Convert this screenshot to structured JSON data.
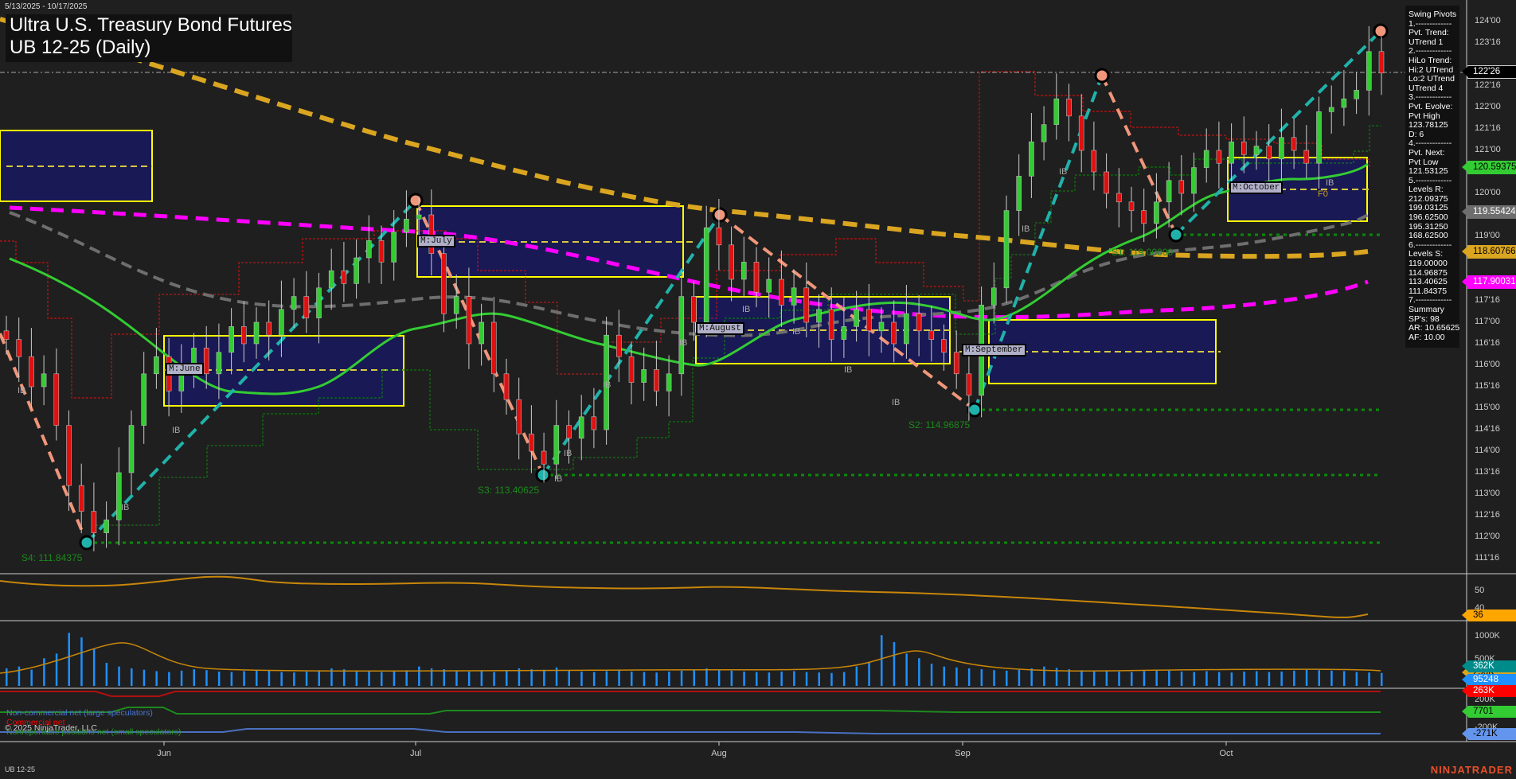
{
  "header": {
    "date_range": "5/13/2025 - 10/17/2025",
    "title_line1": "Ultra U.S. Treasury Bond Futures",
    "title_line2": "UB 12-25 (Daily)"
  },
  "swing_pivots": [
    "Swing Pivots",
    "1.-------------",
    "Pvt. Trend:",
    "UTrend 1",
    "2.-------------",
    "HiLo Trend:",
    "Hi:2 UTrend",
    "Lo:2 UTrend",
    "UTrend 4",
    "3.-------------",
    "Pvt. Evolve:",
    "Pvt High",
    "123.78125",
    "D: 6",
    "4.-------------",
    "Pvt. Next:",
    "Pvt Low",
    "121.53125",
    "5.-------------",
    "Levels R:",
    "212.09375",
    "199.03125",
    "196.62500",
    "195.31250",
    "168.62500",
    "6.-------------",
    "Levels S:",
    "119.00000",
    "114.96875",
    "113.40625",
    "111.84375",
    "7.-------------",
    "Summary",
    "SP's: 98",
    "AR: 10.65625",
    "AF: 10.00"
  ],
  "price_axis_ticks": [
    "124'00",
    "123'16",
    "122'16",
    "122'00",
    "121'16",
    "121'00",
    "120'00",
    "119'00",
    "117'16",
    "117'00",
    "116'16",
    "116'00",
    "115'16",
    "115'00",
    "114'16",
    "114'00",
    "113'16",
    "113'00",
    "112'16",
    "112'00",
    "111'16"
  ],
  "price_badges": [
    {
      "label": "122'26",
      "bg": "#000000",
      "fg": "#ffffff",
      "border": "#cccccc"
    },
    {
      "label": "120.59375",
      "bg": "#33cc33",
      "fg": "#000000",
      "border": "#33cc33"
    },
    {
      "label": "119.55424",
      "bg": "#6e6e6e",
      "fg": "#ffffff",
      "border": "#6e6e6e"
    },
    {
      "label": "118.60766",
      "bg": "#daa520",
      "fg": "#000000",
      "border": "#daa520"
    },
    {
      "label": "117.90031",
      "bg": "#ff00ff",
      "fg": "#ffffff",
      "border": "#ff00ff"
    }
  ],
  "indicator_axis": {
    "ticks": [
      "50",
      "40"
    ],
    "badge": "36"
  },
  "volume_axis": {
    "ticks": [
      "1000K",
      "500K"
    ],
    "badges": [
      "362K",
      "290K",
      "95248"
    ]
  },
  "cot_axis": {
    "ticks": [
      "200K",
      "-200K"
    ],
    "badges": [
      "263K",
      "7701",
      "-271K"
    ]
  },
  "month_boxes": [
    "M:June",
    "M:July",
    "M:August",
    "M:September",
    "M:October"
  ],
  "support_labels": [
    "S4: 111.84375",
    "S3: 113.40625",
    "S2: 114.96875",
    "S1: 119.00000"
  ],
  "ib_label": "IB",
  "fo_label": "F0",
  "x_axis": [
    "Jun",
    "Jul",
    "Aug",
    "Sep",
    "Oct"
  ],
  "legend": {
    "noncommercial": "Non-commercial net (large speculators)",
    "commercial": "Commercial net",
    "copyright": "© 2025 NinjaTrader, LLC",
    "nonreportable": "Nonreportable positions net (small speculators)"
  },
  "footer": {
    "instrument": "UB 12-25",
    "logo": "NINJATRADER"
  },
  "colors": {
    "up": "#33cc33",
    "down": "#e01010",
    "box_fill": "#191955",
    "box_stroke": "#ffff00",
    "teal": "#20b2aa",
    "salmon": "#f0967a",
    "orange_ma": "#daa520",
    "magenta_ma": "#ff00ff",
    "gray_ma": "#6e6e6e",
    "green_ma": "#33cc33",
    "volume": "#1e90ff"
  },
  "chart_data": {
    "type": "candlestick",
    "title": "Ultra U.S. Treasury Bond Futures UB 12-25 (Daily)",
    "x_range": [
      "5/13/2025",
      "10/17/2025"
    ],
    "ylim": [
      111.25,
      124.25
    ],
    "last_price": 122.8125,
    "closes": [
      116.6,
      116.2,
      115.5,
      115.8,
      114.6,
      113.2,
      112.6,
      112.1,
      112.4,
      113.5,
      114.6,
      115.8,
      116.2,
      115.4,
      115.9,
      116.4,
      115.8,
      116.3,
      116.9,
      116.5,
      117.0,
      116.7,
      117.3,
      117.6,
      117.1,
      117.8,
      118.2,
      117.9,
      118.5,
      118.9,
      118.4,
      119.1,
      119.4,
      119.5,
      118.6,
      117.2,
      117.6,
      116.5,
      117.0,
      115.8,
      115.2,
      114.4,
      114.0,
      113.7,
      114.6,
      114.3,
      114.8,
      114.5,
      116.7,
      116.2,
      115.6,
      115.9,
      115.4,
      115.8,
      117.6,
      117.0,
      119.2,
      118.8,
      118.0,
      118.4,
      117.7,
      118.0,
      117.4,
      117.8,
      117.0,
      117.3,
      116.6,
      116.9,
      117.3,
      116.8,
      117.0,
      116.5,
      117.2,
      116.8,
      116.6,
      116.3,
      115.8,
      115.3,
      117.4,
      117.8,
      119.6,
      120.4,
      121.2,
      121.6,
      122.2,
      121.8,
      121.0,
      120.5,
      120.0,
      119.8,
      119.6,
      119.3,
      119.8,
      120.3,
      120.0,
      120.6,
      121.0,
      120.7,
      121.2,
      120.9,
      121.1,
      120.8,
      121.3,
      121.0,
      120.7,
      121.9,
      122.0,
      122.2,
      122.4,
      123.3,
      122.8
    ],
    "pivots": [
      {
        "type": "low",
        "label": "S4",
        "value": 111.84375
      },
      {
        "type": "high",
        "value": 119.8
      },
      {
        "type": "low",
        "label": "S3",
        "value": 113.40625
      },
      {
        "type": "high",
        "value": 119.5
      },
      {
        "type": "low",
        "label": "S2",
        "value": 114.96875
      },
      {
        "type": "high",
        "value": 122.75
      },
      {
        "type": "low",
        "label": "S1",
        "value": 119.0
      },
      {
        "type": "high",
        "value": 123.78125
      }
    ],
    "volume_k": [
      380,
      420,
      350,
      600,
      700,
      1150,
      1050,
      800,
      500,
      420,
      380,
      350,
      320,
      300,
      330,
      360,
      340,
      310,
      300,
      320,
      350,
      330,
      300,
      290,
      310,
      340,
      380,
      360,
      330,
      310,
      300,
      320,
      340,
      420,
      380,
      360,
      330,
      310,
      320,
      300,
      340,
      380,
      360,
      350,
      400,
      330,
      310,
      300,
      320,
      340,
      310,
      300,
      290,
      310,
      330,
      350,
      380,
      360,
      330,
      310,
      300,
      290,
      310,
      320,
      300,
      290,
      280,
      300,
      420,
      500,
      1100,
      950,
      700,
      600,
      480,
      420,
      400,
      380,
      360,
      340,
      330,
      350,
      380,
      420,
      390,
      360,
      340,
      330,
      320,
      310,
      300,
      320,
      340,
      330,
      310,
      300,
      320,
      300,
      290,
      310,
      320,
      300,
      310,
      330,
      350,
      340,
      330,
      320,
      300,
      290,
      280
    ],
    "indicator_last": 36,
    "cot_last": {
      "commercial_k": 263,
      "nonreportable": 7701,
      "noncommercial_k": -271
    }
  }
}
